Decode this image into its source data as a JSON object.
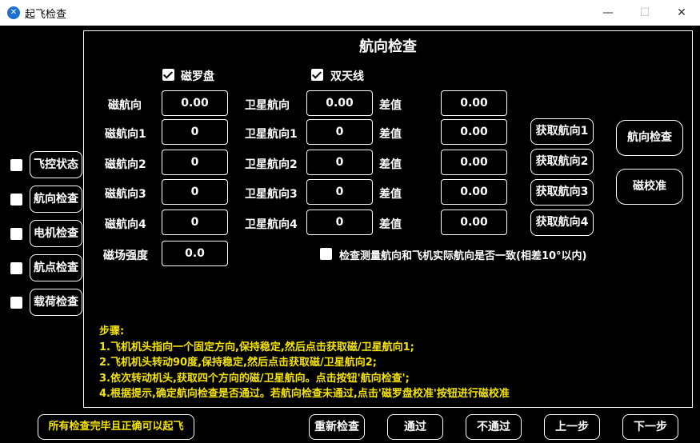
{
  "window": {
    "title": "起飞检查",
    "minimize": "—",
    "maximize": "☐",
    "close": "✕",
    "icon": "app-logo-icon"
  },
  "sidebar": {
    "items": [
      {
        "label": "飞控状态",
        "checked": false
      },
      {
        "label": "航向检查",
        "checked": false
      },
      {
        "label": "电机检查",
        "checked": false
      },
      {
        "label": "航点检查",
        "checked": false
      },
      {
        "label": "载荷检查",
        "checked": false
      }
    ]
  },
  "panel": {
    "title": "航向检查",
    "compass_checkbox": {
      "label": "磁罗盘",
      "checked": true
    },
    "antenna_checkbox": {
      "label": "双天线",
      "checked": true
    },
    "rows": [
      {
        "mag_label": "磁航向",
        "mag_value": "0.00",
        "sat_label": "卫星航向",
        "sat_value": "0.00",
        "diff_label": "差值",
        "diff_value": "0.00"
      },
      {
        "mag_label": "磁航向1",
        "mag_value": "0",
        "sat_label": "卫星航向1",
        "sat_value": "0",
        "diff_label": "差值",
        "diff_value": "0.00",
        "get_label": "获取航向1"
      },
      {
        "mag_label": "磁航向2",
        "mag_value": "0",
        "sat_label": "卫星航向2",
        "sat_value": "0",
        "diff_label": "差值",
        "diff_value": "0.00",
        "get_label": "获取航向2"
      },
      {
        "mag_label": "磁航向3",
        "mag_value": "0",
        "sat_label": "卫星航向3",
        "sat_value": "0",
        "diff_label": "差值",
        "diff_value": "0.00",
        "get_label": "获取航向3"
      },
      {
        "mag_label": "磁航向4",
        "mag_value": "0",
        "sat_label": "卫星航向4",
        "sat_value": "0",
        "diff_label": "差值",
        "diff_value": "0.00",
        "get_label": "获取航向4"
      }
    ],
    "field_strength": {
      "label": "磁场强度",
      "value": "0.0"
    },
    "consistency_checkbox": {
      "label": "检查测量航向和飞机实际航向是否一致(相差10°以内)",
      "checked": false
    },
    "heading_check_button": "航向检查",
    "calibrate_button": "磁校准",
    "steps": [
      "步骤:",
      "1.飞机机头指向一个固定方向,保持稳定,然后点击获取磁/卫星航向1;",
      "2.飞机机头转动90度,保持稳定,然后点击获取磁/卫星航向2;",
      "3.依次转动机头,获取四个方向的磁/卫星航向。点击按钮'航向检查';",
      "4.根据提示,确定航向检查是否通过。若航向检查未通过,点击'磁罗盘校准'按钮进行磁校准"
    ]
  },
  "footer": {
    "status": "所有检查完毕且正确可以起飞",
    "recheck": "重新检查",
    "pass": "通过",
    "fail": "不通过",
    "prev": "上一步",
    "next": "下一步"
  },
  "colors": {
    "background": "#000000",
    "accent_text": "#f5e400",
    "titlebar": "#ffffff"
  }
}
